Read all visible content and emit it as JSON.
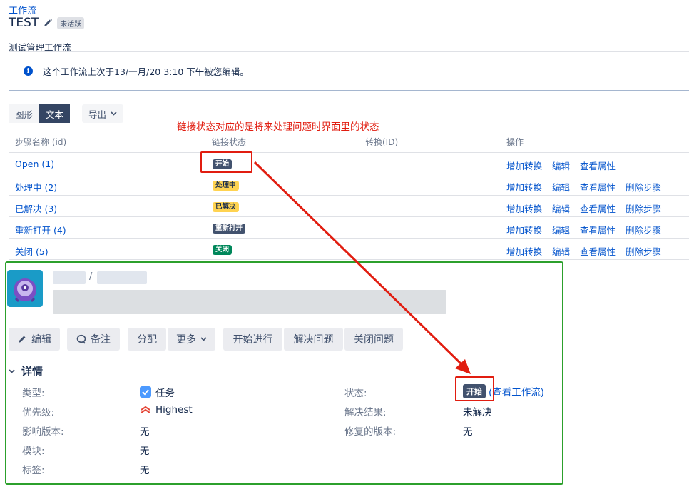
{
  "breadcrumb": "工作流",
  "workflow": {
    "title": "TEST",
    "inactive_badge": "未活跃",
    "description": "测试管理工作流"
  },
  "info": {
    "message": "这个工作流上次于13/一月/20 3:10 下午被您编辑。"
  },
  "view_toggle": {
    "diagram": "图形",
    "text": "文本",
    "export": "导出"
  },
  "annotation": "链接状态对应的是将来处理问题时界面里的状态",
  "table": {
    "headers": {
      "step": "步骤名称 (id)",
      "status": "链接状态",
      "transition": "转换(ID)",
      "ops": "操作"
    },
    "rows": [
      {
        "step": "Open (1)",
        "status": "开始",
        "ops": [
          "增加转换",
          "编辑",
          "查看属性"
        ]
      },
      {
        "step": "处理中 (2)",
        "status": "处理中",
        "ops": [
          "增加转换",
          "编辑",
          "查看属性",
          "删除步骤"
        ]
      },
      {
        "step": "已解决 (3)",
        "status": "已解决",
        "ops": [
          "增加转换",
          "编辑",
          "查看属性",
          "删除步骤"
        ]
      },
      {
        "step": "重新打开 (4)",
        "status": "重新打开",
        "ops": [
          "增加转换",
          "编辑",
          "查看属性",
          "删除步骤"
        ]
      },
      {
        "step": "关闭 (5)",
        "status": "关闭",
        "ops": [
          "增加转换",
          "编辑",
          "查看属性",
          "删除步骤"
        ]
      }
    ]
  },
  "issue": {
    "breadcrumb_sep": "/",
    "actions": {
      "edit": "编辑",
      "comment": "备注",
      "assign": "分配",
      "more": "更多",
      "start": "开始进行",
      "resolve": "解决问题",
      "close": "关闭问题"
    },
    "details": {
      "heading": "详情",
      "type_label": "类型:",
      "type_value": "任务",
      "priority_label": "优先级:",
      "priority_value": "Highest",
      "affects_label": "影响版本:",
      "affects_value": "无",
      "component_label": "模块:",
      "component_value": "无",
      "labels_label": "标签:",
      "labels_value": "无",
      "status_label": "状态:",
      "status_value": "开始",
      "view_workflow": "(查看工作流)",
      "resolution_label": "解决结果:",
      "resolution_value": "未解决",
      "fix_label": "修复的版本:",
      "fix_value": "无"
    }
  },
  "colors": {
    "link": "#0052cc",
    "annotation_red": "#e11d10",
    "green_frame": "#2ca02c"
  }
}
